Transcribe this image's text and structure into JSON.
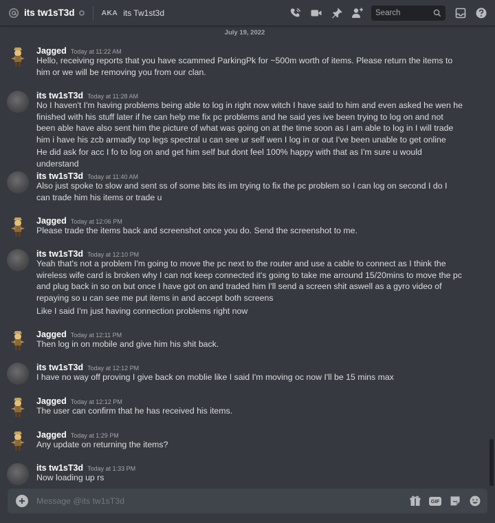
{
  "header": {
    "dm_name": "its tw1sT3d",
    "aka_label": "AKA",
    "aka_name": "its Tw1st3d",
    "search_placeholder": "Search"
  },
  "date_separator": "July 19, 2022",
  "messages": [
    {
      "author": "Jagged",
      "timestamp": "Today at 11:22 AM",
      "avatar": "jagged-avatar",
      "text": "Hello, receiving reports that you have scammed ParkingPk for ~500m worth of items. Please return the items to him or we will be removing you from our clan."
    },
    {
      "author": "its tw1sT3d",
      "timestamp": "Today at 11:28 AM",
      "avatar": "gray-avatar",
      "text": "No I haven't I'm having problems being able to log in right now witch I have said to him and even asked he wen he finished with his stuff later if he can help me fix pc problems and he said yes ive been trying to log on and not been able have also sent him the picture of what was going on at the time soon as I am able to log in I will trade him i have his zcb armadly top legs spectral u can see ur self wen I log in or out I've been unable to get online",
      "text2": "He did ask for acc I fo to log on and get him self but dont feel 100% happy with that as I'm sure u would understand"
    },
    {
      "author": "its tw1sT3d",
      "timestamp": "Today at 11:40 AM",
      "avatar": "gray-avatar",
      "text": "Also just spoke to slow and sent ss of some bits its im trying to fix the pc problem so I can log on second I do I can trade him his items or trade u"
    },
    {
      "author": "Jagged",
      "timestamp": "Today at 12:06 PM",
      "avatar": "jagged-avatar",
      "text": "Please trade the items back and screenshot once you do. Send the screenshot to me."
    },
    {
      "author": "its tw1sT3d",
      "timestamp": "Today at 12:10 PM",
      "avatar": "gray-avatar",
      "text": "Yeah that's not a problem I'm going to move the pc next to the router and use a cable to connect as I think the wireless wife card is broken why I can not keep connected it's going to take me arround 15/20mins to move the pc and plug back in so on but once I have got on and traded him I'll send a screen shit aswell as a gyro video of repaying so u can see me put items in and accept both screens",
      "text2": "Like I said I'm just having connection problems right now"
    },
    {
      "author": "Jagged",
      "timestamp": "Today at 12:11 PM",
      "avatar": "jagged-avatar",
      "text": "Then log in on mobile and give him his shit back."
    },
    {
      "author": "its tw1sT3d",
      "timestamp": "Today at 12:12 PM",
      "avatar": "gray-avatar",
      "text": "I have no way off proving I give back on moblie like I said I'm moving oc now I'll be 15 mins max"
    },
    {
      "author": "Jagged",
      "timestamp": "Today at 12:12 PM",
      "avatar": "jagged-avatar",
      "text": "The user can confirm that he has received his items."
    },
    {
      "author": "Jagged",
      "timestamp": "Today at 1:29 PM",
      "avatar": "jagged-avatar",
      "text": "Any update on returning the items?"
    },
    {
      "author": "its tw1sT3d",
      "timestamp": "Today at 1:33 PM",
      "avatar": "gray-avatar",
      "text": "Now loading up rs"
    }
  ],
  "composer": {
    "placeholder": "Message @its tw1sT3d",
    "gif_label": "GIF"
  },
  "colors": {
    "background": "#36393f",
    "header_text": "#ffffff",
    "body_text": "#dcddde",
    "muted_text": "#a3a6aa",
    "input_bg": "#40444b",
    "search_bg": "#202225"
  }
}
